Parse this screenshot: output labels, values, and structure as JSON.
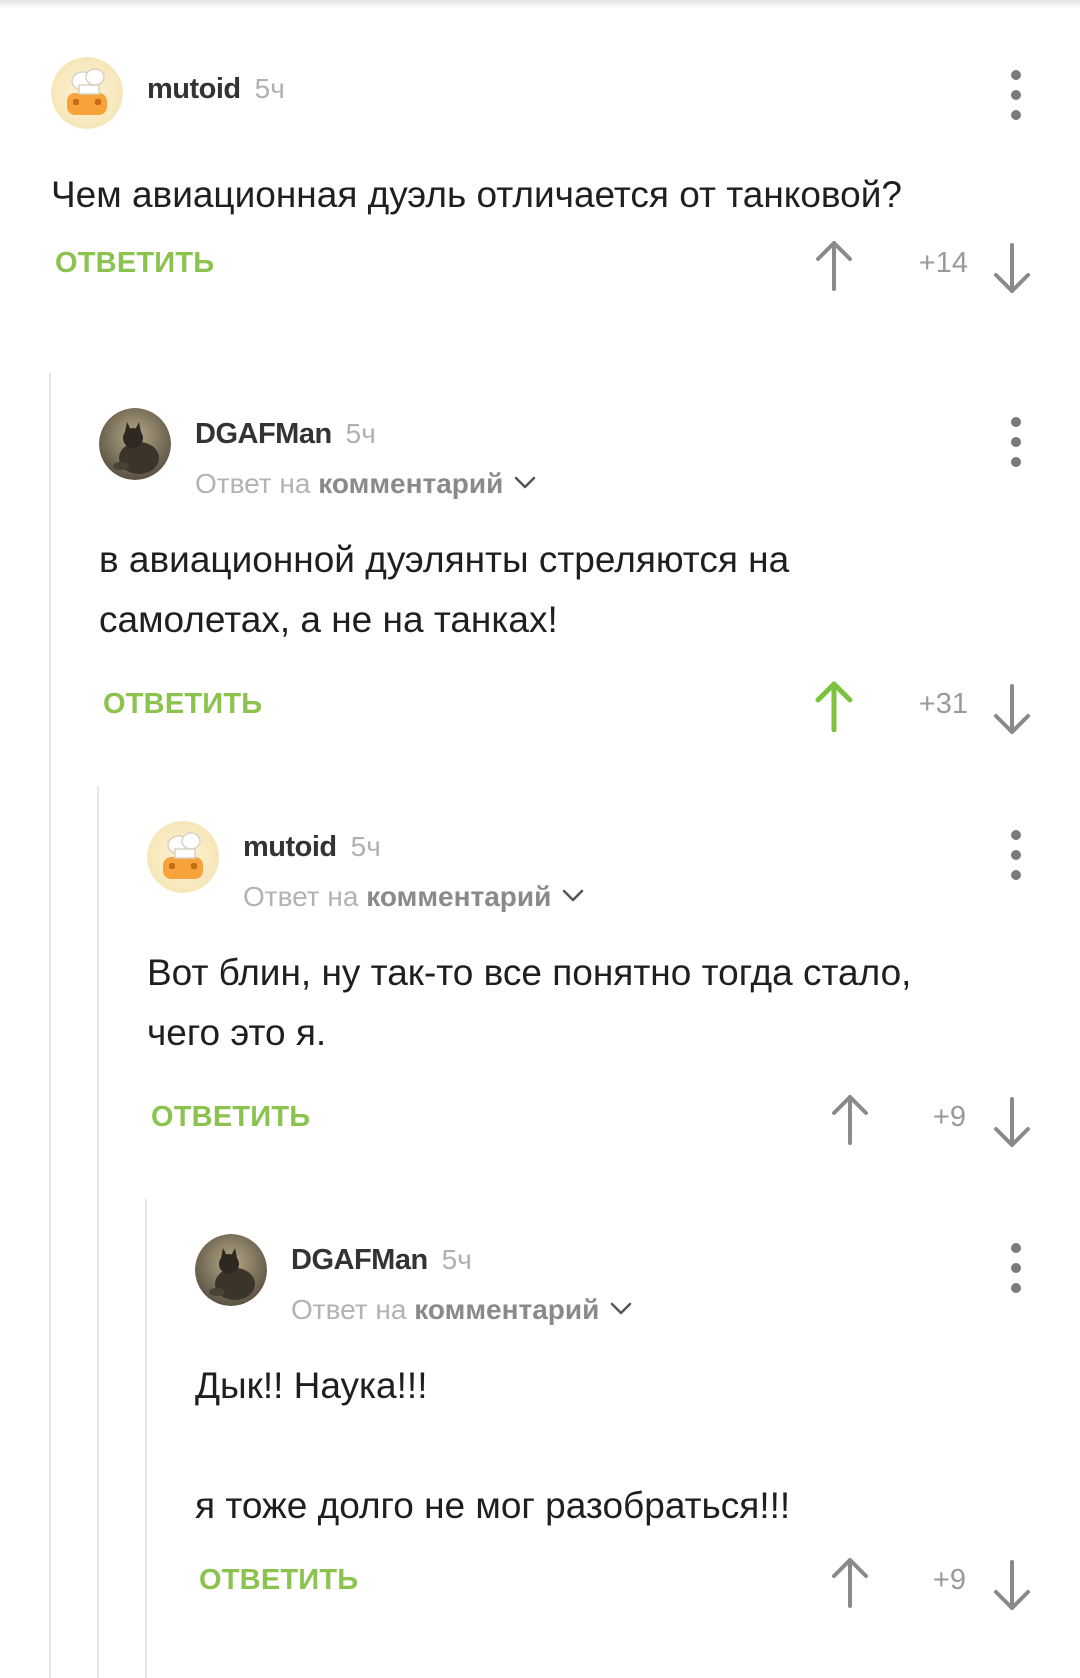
{
  "comments": [
    {
      "author": "mutoid",
      "time": "5ч",
      "avatar_icon": "chef-hat-avatar-icon",
      "reply_prefix": "",
      "reply_link": "",
      "text": "Чем авиационная дуэль отличается от танковой?",
      "reply_label": "ОТВЕТИТЬ",
      "score": "+14",
      "upvoted": false
    },
    {
      "author": "DGAFMan",
      "time": "5ч",
      "avatar_icon": "cat-photo-avatar-icon",
      "reply_prefix": "Ответ на ",
      "reply_link": "комментарий",
      "text": "в авиационной дуэлянты стреляются  на\nсамолетах, а не на танках!",
      "reply_label": "ОТВЕТИТЬ",
      "score": "+31",
      "upvoted": true
    },
    {
      "author": "mutoid",
      "time": "5ч",
      "avatar_icon": "chef-hat-avatar-icon",
      "reply_prefix": "Ответ на ",
      "reply_link": "комментарий",
      "text": "Вот блин, ну так-то все понятно тогда стало,\nчего это я.",
      "reply_label": "ОТВЕТИТЬ",
      "score": "+9",
      "upvoted": false
    },
    {
      "author": "DGAFMan",
      "time": "5ч",
      "avatar_icon": "cat-photo-avatar-icon",
      "reply_prefix": "Ответ на ",
      "reply_link": "комментарий",
      "text": "Дык!! Наука!!!\n\nя тоже долго не мог разобраться!!!",
      "reply_label": "ОТВЕТИТЬ",
      "score": "+9",
      "upvoted": false
    }
  ],
  "colors": {
    "accent_green": "#8cc34f",
    "upvote_active": "#7cc33f",
    "icon_gray": "#8a8a8a",
    "thread_line": "#e6e6e6"
  }
}
